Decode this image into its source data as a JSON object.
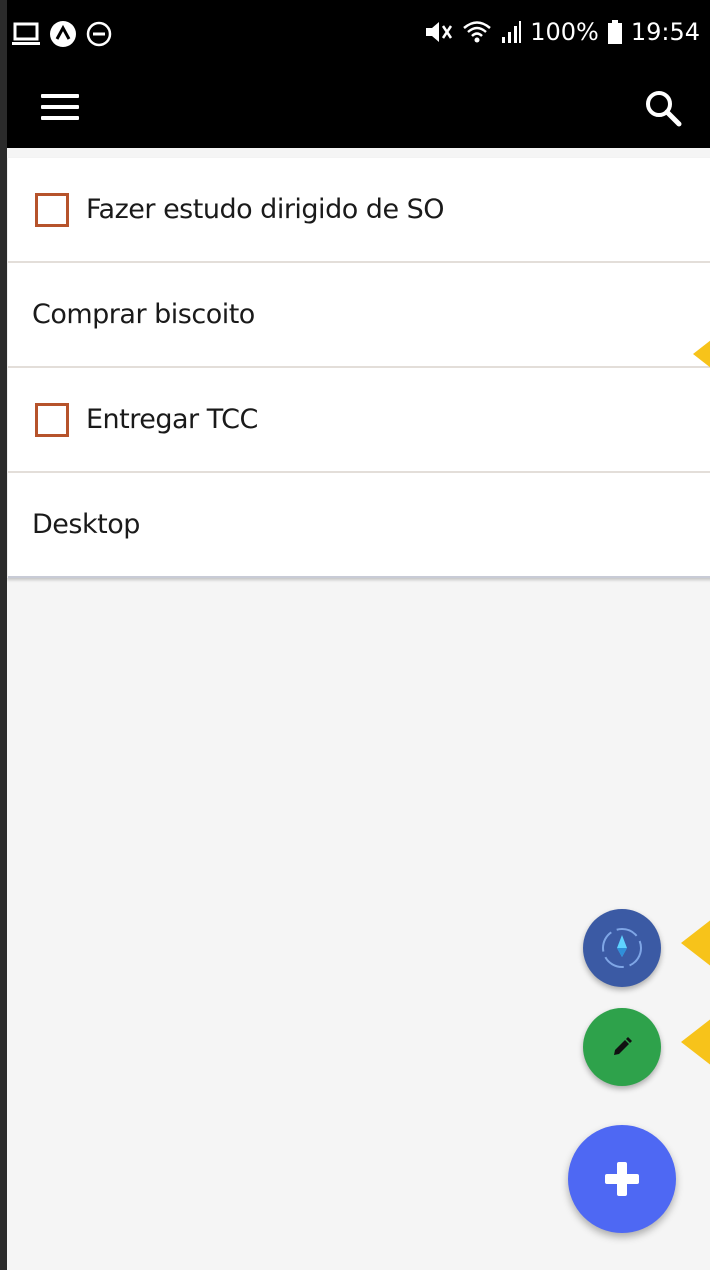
{
  "status_bar": {
    "left_icons": [
      "laptop-icon",
      "app-badge-icon",
      "minus-circle-icon"
    ],
    "right_icons": [
      "mute-icon",
      "wifi-icon",
      "signal-icon",
      "battery-icon"
    ],
    "battery": "100%",
    "time": "19:54"
  },
  "app_bar": {
    "menu_icon": "hamburger-menu-icon",
    "search_icon": "search-icon"
  },
  "list": {
    "items": [
      {
        "label": "Fazer estudo dirigido de SO",
        "type": "checkbox",
        "checked": false
      },
      {
        "label": "Comprar biscoito",
        "type": "note"
      },
      {
        "label": "Entregar TCC",
        "type": "checkbox",
        "checked": false
      },
      {
        "label": "Desktop",
        "type": "note"
      }
    ]
  },
  "fabs": {
    "compass": "compass-icon",
    "edit": "pencil-icon",
    "add": "plus-icon"
  },
  "colors": {
    "checkbox_border": "#b6532b",
    "fab_compass": "#3b5aa4",
    "fab_edit": "#2ea24b",
    "fab_add": "#4e68f3",
    "annotation": "#f7c31a"
  }
}
